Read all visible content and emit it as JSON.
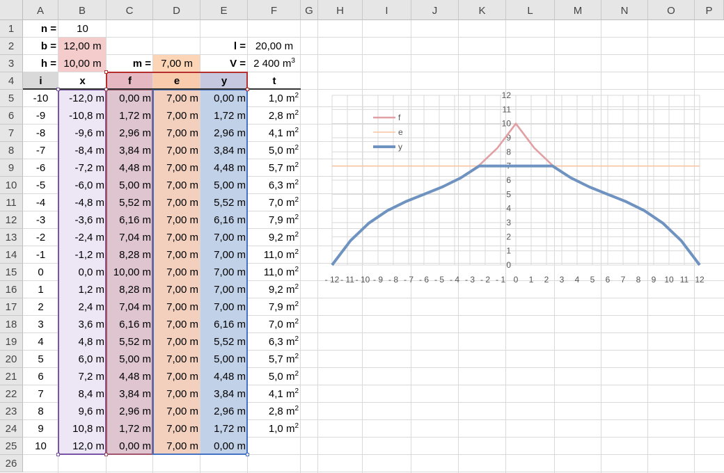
{
  "columns": [
    "A",
    "B",
    "C",
    "D",
    "E",
    "F",
    "G",
    "H",
    "I",
    "J",
    "K",
    "L",
    "M",
    "N",
    "O",
    "P"
  ],
  "rows": [
    "1",
    "2",
    "3",
    "4",
    "5",
    "6",
    "7",
    "8",
    "9",
    "10",
    "11",
    "12",
    "13",
    "14",
    "15",
    "16",
    "17",
    "18",
    "19",
    "20",
    "21",
    "22",
    "23",
    "24",
    "25",
    "26"
  ],
  "params": {
    "n_label": "n =",
    "n_value": "10",
    "b_label": "b =",
    "b_value": "12,00 m",
    "h_label": "h =",
    "h_value": "10,00 m",
    "m_label": "m =",
    "m_value": "7,00 m",
    "l_label": "l =",
    "l_value": "20,00 m",
    "V_label": "V =",
    "V_value": "2 400 m",
    "V_unit_sup": "3"
  },
  "table": {
    "headers": {
      "i": "i",
      "x": "x",
      "f": "f",
      "e": "e",
      "y": "y",
      "t": "t"
    },
    "area_sup": "2",
    "rows": [
      {
        "i": "-10",
        "x": "-12,0 m",
        "f": "0,00 m",
        "e": "7,00 m",
        "y": "0,00 m",
        "t": "1,0 m"
      },
      {
        "i": "-9",
        "x": "-10,8 m",
        "f": "1,72 m",
        "e": "7,00 m",
        "y": "1,72 m",
        "t": "2,8 m"
      },
      {
        "i": "-8",
        "x": "-9,6 m",
        "f": "2,96 m",
        "e": "7,00 m",
        "y": "2,96 m",
        "t": "4,1 m"
      },
      {
        "i": "-7",
        "x": "-8,4 m",
        "f": "3,84 m",
        "e": "7,00 m",
        "y": "3,84 m",
        "t": "5,0 m"
      },
      {
        "i": "-6",
        "x": "-7,2 m",
        "f": "4,48 m",
        "e": "7,00 m",
        "y": "4,48 m",
        "t": "5,7 m"
      },
      {
        "i": "-5",
        "x": "-6,0 m",
        "f": "5,00 m",
        "e": "7,00 m",
        "y": "5,00 m",
        "t": "6,3 m"
      },
      {
        "i": "-4",
        "x": "-4,8 m",
        "f": "5,52 m",
        "e": "7,00 m",
        "y": "5,52 m",
        "t": "7,0 m"
      },
      {
        "i": "-3",
        "x": "-3,6 m",
        "f": "6,16 m",
        "e": "7,00 m",
        "y": "6,16 m",
        "t": "7,9 m"
      },
      {
        "i": "-2",
        "x": "-2,4 m",
        "f": "7,04 m",
        "e": "7,00 m",
        "y": "7,00 m",
        "t": "9,2 m"
      },
      {
        "i": "-1",
        "x": "-1,2 m",
        "f": "8,28 m",
        "e": "7,00 m",
        "y": "7,00 m",
        "t": "11,0 m"
      },
      {
        "i": "0",
        "x": "0,0 m",
        "f": "10,00 m",
        "e": "7,00 m",
        "y": "7,00 m",
        "t": "11,0 m"
      },
      {
        "i": "1",
        "x": "1,2 m",
        "f": "8,28 m",
        "e": "7,00 m",
        "y": "7,00 m",
        "t": "9,2 m"
      },
      {
        "i": "2",
        "x": "2,4 m",
        "f": "7,04 m",
        "e": "7,00 m",
        "y": "7,00 m",
        "t": "7,9 m"
      },
      {
        "i": "3",
        "x": "3,6 m",
        "f": "6,16 m",
        "e": "7,00 m",
        "y": "6,16 m",
        "t": "7,0 m"
      },
      {
        "i": "4",
        "x": "4,8 m",
        "f": "5,52 m",
        "e": "7,00 m",
        "y": "5,52 m",
        "t": "6,3 m"
      },
      {
        "i": "5",
        "x": "6,0 m",
        "f": "5,00 m",
        "e": "7,00 m",
        "y": "5,00 m",
        "t": "5,7 m"
      },
      {
        "i": "6",
        "x": "7,2 m",
        "f": "4,48 m",
        "e": "7,00 m",
        "y": "4,48 m",
        "t": "5,0 m"
      },
      {
        "i": "7",
        "x": "8,4 m",
        "f": "3,84 m",
        "e": "7,00 m",
        "y": "3,84 m",
        "t": "4,1 m"
      },
      {
        "i": "8",
        "x": "9,6 m",
        "f": "2,96 m",
        "e": "7,00 m",
        "y": "2,96 m",
        "t": "2,8 m"
      },
      {
        "i": "9",
        "x": "10,8 m",
        "f": "1,72 m",
        "e": "7,00 m",
        "y": "1,72 m",
        "t": "1,0 m"
      },
      {
        "i": "10",
        "x": "12,0 m",
        "f": "0,00 m",
        "e": "7,00 m",
        "y": "0,00 m",
        "t": ""
      }
    ]
  },
  "colors": {
    "b_fill": "#f4cccc",
    "m_fill": "#fbd5b5",
    "header_fill": "#d9d9d9",
    "x_fill": "#ece6f5",
    "f_fill": "#dec5cf",
    "e_fill": "#f3d0bd",
    "y_fill": "#c1d1e8",
    "f_header": "#e6b9c2",
    "e_header": "#f8cbad",
    "y_header": "#c5c8de",
    "x_border": "#7a52a6",
    "f_border": "#a0556c",
    "y_border": "#4472c4",
    "header_border": "#b52e2e",
    "series_f": "#e0a0a4",
    "series_e": "#f8c3a0",
    "series_y": "#6f93c0"
  },
  "chart_data": {
    "type": "line",
    "series": [
      {
        "name": "f",
        "color": "#e0a0a4",
        "x": [
          -12,
          -10.8,
          -9.6,
          -8.4,
          -7.2,
          -6,
          -4.8,
          -3.6,
          -2.4,
          -1.2,
          0,
          1.2,
          2.4,
          3.6,
          4.8,
          6,
          7.2,
          8.4,
          9.6,
          10.8,
          12
        ],
        "y": [
          0,
          1.72,
          2.96,
          3.84,
          4.48,
          5,
          5.52,
          6.16,
          7.04,
          8.28,
          10,
          8.28,
          7.04,
          6.16,
          5.52,
          5,
          4.48,
          3.84,
          2.96,
          1.72,
          0
        ]
      },
      {
        "name": "e",
        "color": "#f8c3a0",
        "x": [
          -12,
          -10.8,
          -9.6,
          -8.4,
          -7.2,
          -6,
          -4.8,
          -3.6,
          -2.4,
          -1.2,
          0,
          1.2,
          2.4,
          3.6,
          4.8,
          6,
          7.2,
          8.4,
          9.6,
          10.8,
          12
        ],
        "y": [
          7,
          7,
          7,
          7,
          7,
          7,
          7,
          7,
          7,
          7,
          7,
          7,
          7,
          7,
          7,
          7,
          7,
          7,
          7,
          7,
          7
        ]
      },
      {
        "name": "y",
        "color": "#6f93c0",
        "x": [
          -12,
          -10.8,
          -9.6,
          -8.4,
          -7.2,
          -6,
          -4.8,
          -3.6,
          -2.4,
          -1.2,
          0,
          1.2,
          2.4,
          3.6,
          4.8,
          6,
          7.2,
          8.4,
          9.6,
          10.8,
          12
        ],
        "y": [
          0,
          1.72,
          2.96,
          3.84,
          4.48,
          5,
          5.52,
          6.16,
          7,
          7,
          7,
          7,
          7,
          6.16,
          5.52,
          5,
          4.48,
          3.84,
          2.96,
          1.72,
          0
        ]
      }
    ],
    "xlim": [
      -12,
      12
    ],
    "ylim": [
      0,
      12
    ],
    "xticks": [
      "- 12",
      "- 11",
      "- 10",
      "- 9",
      "- 8",
      "- 7",
      "- 6",
      "- 5",
      "- 4",
      "- 3",
      "- 2",
      "- 1",
      "0",
      "1",
      "2",
      "3",
      "4",
      "5",
      "6",
      "7",
      "8",
      "9",
      "10",
      "11",
      "12"
    ],
    "yticks": [
      "0",
      "1",
      "2",
      "3",
      "4",
      "5",
      "6",
      "7",
      "8",
      "9",
      "10",
      "11",
      "12"
    ],
    "grid": true,
    "legend": "top-left"
  }
}
